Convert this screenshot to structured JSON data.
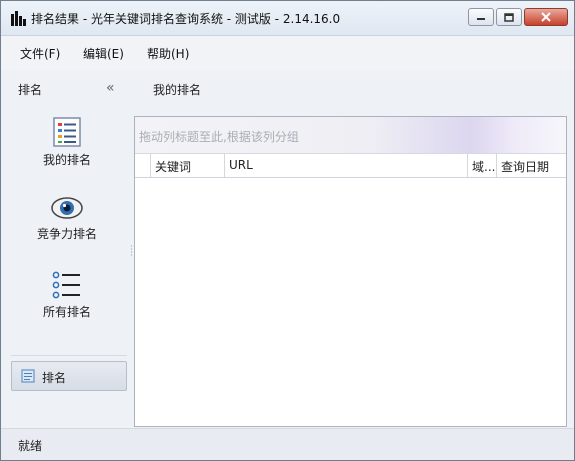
{
  "window": {
    "title": "排名结果 - 光年关键词排名查询系统 - 测试版 - 2.14.16.0"
  },
  "menu": [
    "文件(F)",
    "编辑(E)",
    "帮助(H)"
  ],
  "nav": {
    "title": "排名",
    "collapse_glyph": "«",
    "items": [
      {
        "label": "我的排名",
        "icon": "list-doc-icon"
      },
      {
        "label": "竞争力排名",
        "icon": "eye-icon"
      },
      {
        "label": "所有排名",
        "icon": "bullet-list-icon"
      }
    ],
    "selected": {
      "label": "排名",
      "icon": "document-icon"
    }
  },
  "content": {
    "title": "我的排名",
    "group_hint": "拖动列标题至此,根据该列分组",
    "columns": [
      "关键词",
      "URL",
      "域...",
      "查询日期"
    ]
  },
  "status": {
    "text": "就绪"
  }
}
